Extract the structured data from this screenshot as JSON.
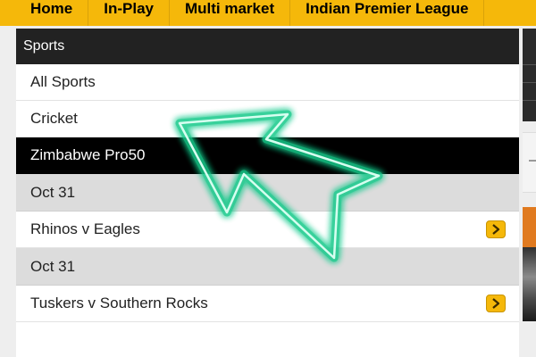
{
  "nav": {
    "items": [
      {
        "label": "Home"
      },
      {
        "label": "In-Play"
      },
      {
        "label": "Multi market"
      },
      {
        "label": "Indian Premier League"
      }
    ]
  },
  "sports": {
    "header": "Sports",
    "all_sports": "All Sports",
    "cricket": "Cricket",
    "competition": "Zimbabwe Pro50",
    "groups": [
      {
        "date": "Oct 31",
        "match": "Rhinos v Eagles"
      },
      {
        "date": "Oct 31",
        "match": "Tuskers v Southern Rocks"
      }
    ]
  },
  "colors": {
    "accent": "#f5b80a",
    "header_bg": "#222222",
    "selected_bg": "#000000",
    "date_bg": "#dcdcdc",
    "arrow": "#1de9a0"
  },
  "icons": {
    "match_chevron": "chevron-right-icon",
    "overlay": "arrow-pointer-icon"
  }
}
